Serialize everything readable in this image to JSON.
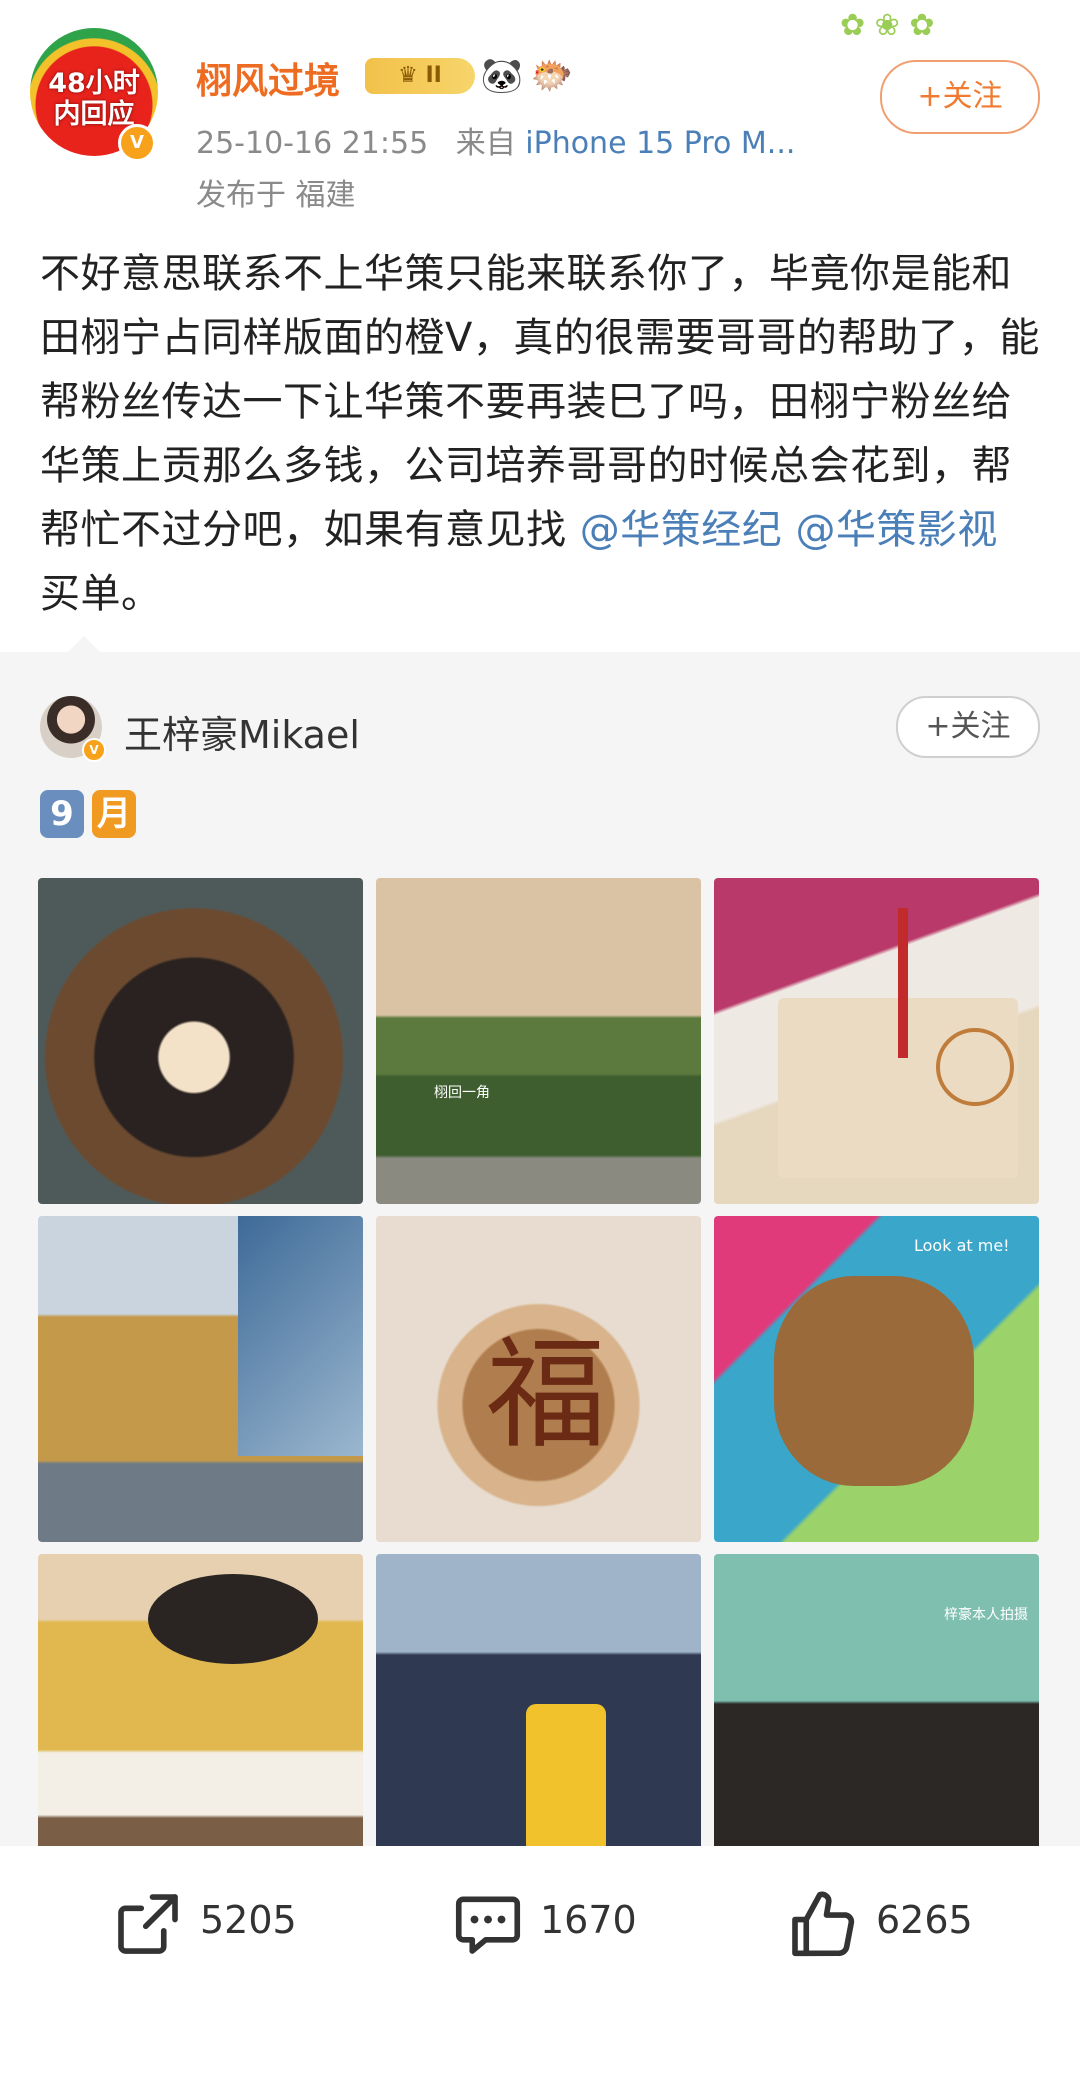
{
  "post": {
    "author": "栩风过境",
    "avatar_text_1": "48小时",
    "avatar_text_2": "内回应",
    "vip_badge": "II",
    "timestamp": "25-10-16 21:55",
    "source_prefix": "来自",
    "source_device": "iPhone 15 Pro M...",
    "location": "发布于 福建",
    "follow_label": "+关注",
    "text_body": "不好意思联系不上华策只能来联系你了，毕竟你是能和田栩宁占同样版面的橙V，真的很需要哥哥的帮助了，能帮粉丝传达一下让华策不要再装巳了吗，田栩宁粉丝给华策上贡那么多钱，公司培养哥哥的时候总会花到，帮帮忙不过分吧，如果有意见找",
    "mention_1": "@华策经纪",
    "mention_2": "@华策影视",
    "text_tail": " 买单。"
  },
  "quoted": {
    "author": "王梓豪Mikael",
    "follow_label": "+关注",
    "month_digit": "9",
    "month_char": "月",
    "captions": [
      "栩回一角",
      "Look at me!",
      "梓豪本人拍摄"
    ]
  },
  "actions": {
    "repost_count": "5205",
    "comment_count": "1670",
    "like_count": "6265"
  },
  "icons": [
    "share-icon",
    "comment-icon",
    "like-icon",
    "verified-icon",
    "panda-icon",
    "fish-icon"
  ],
  "colors": {
    "username": "#ee6c21",
    "link": "#4a7fb8",
    "follow_border": "#f0a070",
    "card_bg": "#f5f5f5"
  }
}
